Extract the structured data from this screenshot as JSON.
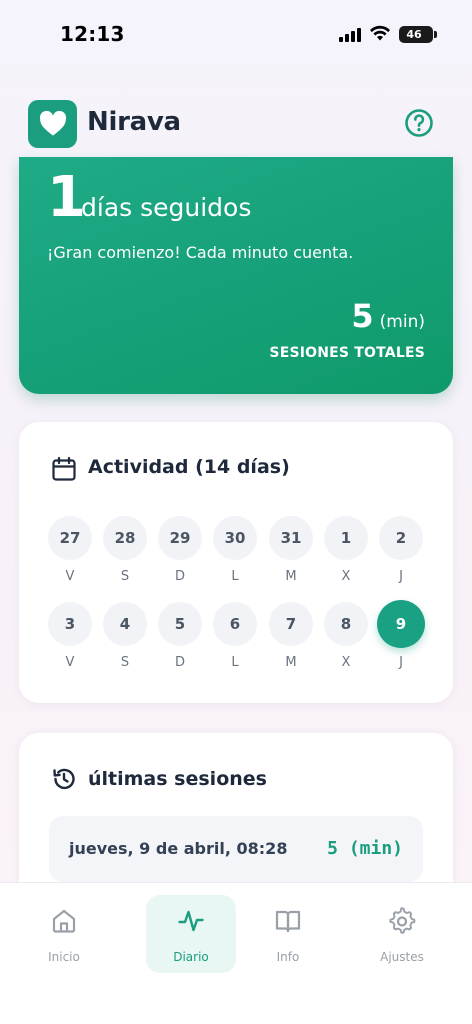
{
  "status_bar": {
    "time": "12:13",
    "battery": "46"
  },
  "header": {
    "app_name": "Nirava",
    "logo_icon": "heart-icon",
    "help_icon": "help-circle-icon"
  },
  "streak": {
    "value": "1",
    "unit": "días seguidos",
    "message": "¡Gran comienzo! Cada minuto cuenta.",
    "total_value": "5",
    "total_unit": "(min)",
    "total_label": "SESIONES TOTALES"
  },
  "activity": {
    "title": "Actividad (14 días)",
    "icon": "calendar-icon",
    "week1": [
      {
        "day": "27",
        "letter": "V"
      },
      {
        "day": "28",
        "letter": "S"
      },
      {
        "day": "29",
        "letter": "D"
      },
      {
        "day": "30",
        "letter": "L"
      },
      {
        "day": "31",
        "letter": "M"
      },
      {
        "day": "1",
        "letter": "X"
      },
      {
        "day": "2",
        "letter": "J"
      }
    ],
    "week2": [
      {
        "day": "3",
        "letter": "V"
      },
      {
        "day": "4",
        "letter": "S"
      },
      {
        "day": "5",
        "letter": "D"
      },
      {
        "day": "6",
        "letter": "L"
      },
      {
        "day": "7",
        "letter": "M"
      },
      {
        "day": "8",
        "letter": "X"
      },
      {
        "day": "9",
        "letter": "J",
        "active": true
      }
    ]
  },
  "sessions": {
    "title": "últimas sesiones",
    "icon": "history-icon",
    "items": [
      {
        "date": "jueves, 9 de abril, 08:28",
        "duration": "5 (min)"
      }
    ]
  },
  "nav": [
    {
      "label": "Inicio",
      "icon": "home-icon"
    },
    {
      "label": "Diario",
      "icon": "activity-icon",
      "active": true
    },
    {
      "label": "Info",
      "icon": "book-icon"
    },
    {
      "label": "Ajustes",
      "icon": "gear-icon"
    }
  ],
  "colors": {
    "accent": "#1a9e7f",
    "card": "#ffffff",
    "background": "#f5f3fb"
  }
}
